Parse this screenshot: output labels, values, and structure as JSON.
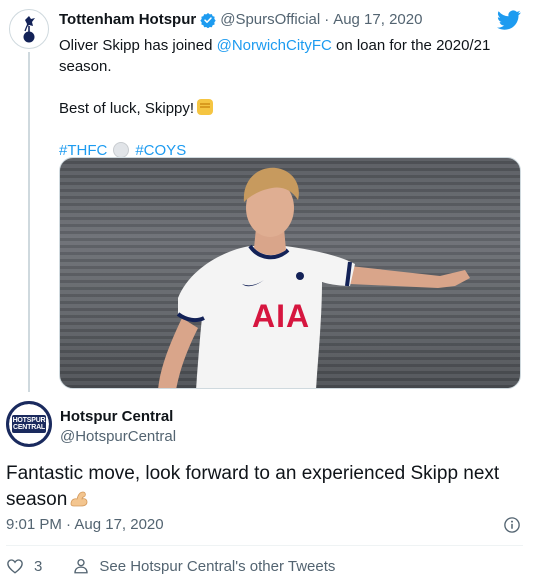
{
  "parent_tweet": {
    "display_name": "Tottenham Hotspur",
    "handle": "@SpursOfficial",
    "separator": "·",
    "date": "Aug 17, 2020",
    "text_line1_before": "Oliver Skipp has joined ",
    "text_mention": "@NorwichCityFC",
    "text_line1_after": " on loan for the 2020/21 season.",
    "text_line2": "Best of luck, Skippy!",
    "hashtag1": "#THFC",
    "hashtag2": "#COYS",
    "image_sponsor": "AIA"
  },
  "reply_tweet": {
    "display_name": "Hotspur Central",
    "handle": "@HotspurCentral",
    "avatar_text_1": "HOTSPUR",
    "avatar_text_2": "CENTRAL",
    "text": "Fantastic move, look forward to an experienced Skipp next season",
    "timestamp": "9:01 PM · Aug 17, 2020",
    "like_count": "3",
    "other_tweets_link": "See Hotspur Central's other Tweets"
  },
  "colors": {
    "link": "#1d9bf0",
    "muted": "#536471",
    "spurs_navy": "#132257",
    "like_red": "#e0245e"
  },
  "icons": [
    "spurs-crest-icon",
    "verified-badge-icon",
    "twitter-bird-icon",
    "fist-emoji-icon",
    "football-emoji-icon",
    "flexed-biceps-emoji-icon",
    "info-icon",
    "heart-icon",
    "person-icon"
  ]
}
